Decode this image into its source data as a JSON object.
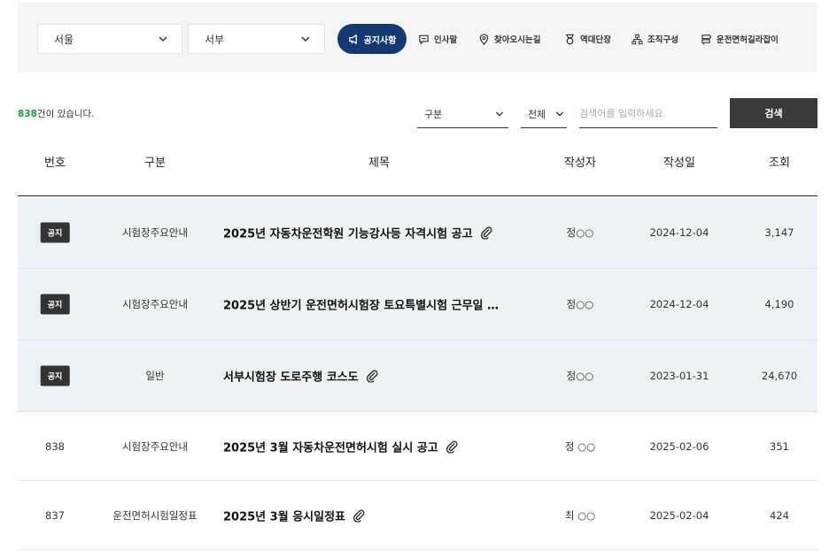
{
  "filters": {
    "city": "서울",
    "branch": "서부"
  },
  "nav": {
    "active": "공지사항",
    "links": [
      "인사말",
      "찾아오시는길",
      "역대단장",
      "조직구성",
      "운전면허길라잡이"
    ]
  },
  "search": {
    "count_num": "838",
    "count_suffix": "건이 있습니다.",
    "category_label": "구분",
    "scope_label": "전체",
    "placeholder": "검색어를 입력하세요",
    "button": "검색"
  },
  "table": {
    "headers": [
      "번호",
      "구분",
      "제목",
      "작성자",
      "작성일",
      "조회"
    ],
    "notice_badge": "공지",
    "rows": [
      {
        "no": "공지",
        "category": "시험장주요안내",
        "title": "2025년 자동차운전학원 기능강사등 자격시험 공고",
        "attach": true,
        "author": "정○○",
        "date": "2024-12-04",
        "views": "3,147",
        "notice": true
      },
      {
        "no": "공지",
        "category": "시험장주요안내",
        "title": "2025년 상반기 운전면허시험장 토요특별시험 근무일 …",
        "attach": false,
        "author": "정○○",
        "date": "2024-12-04",
        "views": "4,190",
        "notice": true
      },
      {
        "no": "공지",
        "category": "일반",
        "title": "서부시험장 도로주행 코스도",
        "attach": true,
        "author": "정○○",
        "date": "2023-01-31",
        "views": "24,670",
        "notice": true
      },
      {
        "no": "838",
        "category": "시험장주요안내",
        "title": "2025년 3월 자동차운전면허시험 실시 공고",
        "attach": true,
        "author": "정 ○○",
        "date": "2025-02-06",
        "views": "351",
        "notice": false
      },
      {
        "no": "837",
        "category": "운전면허시험일정표",
        "title": "2025년 3월 응시일정표",
        "attach": true,
        "author": "최 ○○",
        "date": "2025-02-04",
        "views": "424",
        "notice": false
      }
    ]
  }
}
